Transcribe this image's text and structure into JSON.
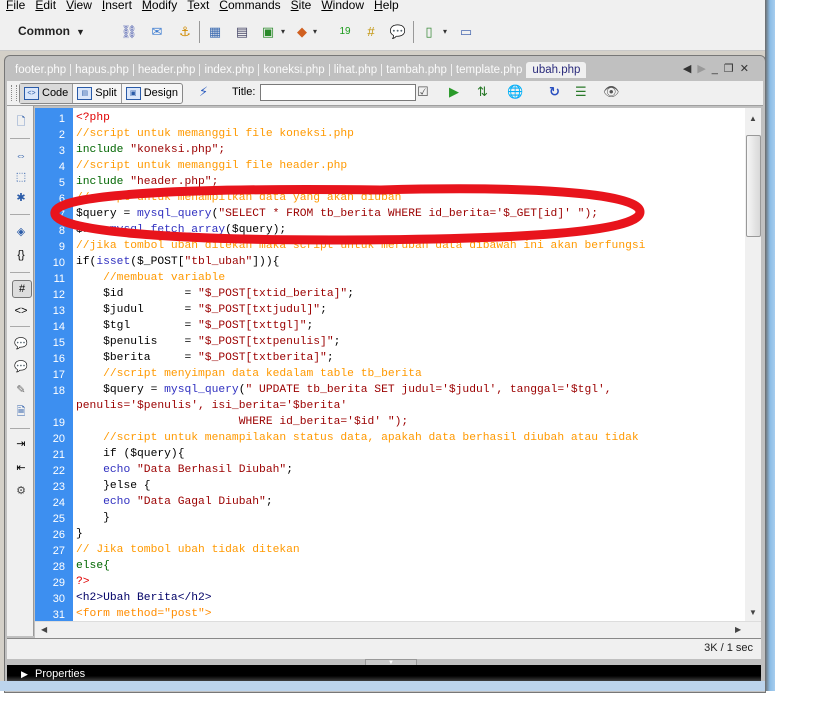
{
  "menu": [
    {
      "label": "File",
      "u": "F"
    },
    {
      "label": "Edit",
      "u": "E"
    },
    {
      "label": "View",
      "u": "V"
    },
    {
      "label": "Insert",
      "u": "I"
    },
    {
      "label": "Modify",
      "u": "M"
    },
    {
      "label": "Text",
      "u": "T"
    },
    {
      "label": "Commands",
      "u": "C"
    },
    {
      "label": "Site",
      "u": "S"
    },
    {
      "label": "Window",
      "u": "W"
    },
    {
      "label": "Help",
      "u": "H"
    }
  ],
  "insert_bar": {
    "category": "Common",
    "icons": [
      "hyperlink-icon",
      "email-link-icon",
      "named-anchor-icon",
      "table-icon",
      "insert-div-icon",
      "image-icon",
      "media-icon",
      "date-icon",
      "server-side-include-icon",
      "comment-icon",
      "head-icon",
      "template-icon"
    ]
  },
  "tabs": [
    "footer.php",
    "hapus.php",
    "header.php",
    "index.php",
    "koneksi.php",
    "lihat.php",
    "tambah.php",
    "template.php",
    "ubah.php"
  ],
  "active_tab": "ubah.php",
  "doc_toolbar": {
    "code_label": "Code",
    "split_label": "Split",
    "design_label": "Design",
    "title_label": "Title:",
    "title_value": ""
  },
  "code_lines": [
    {
      "n": "1",
      "t": "<?php",
      "c": "tag"
    },
    {
      "n": "2",
      "t": "//script untuk memanggil file koneksi.php",
      "c": "cmt"
    },
    {
      "n": "3",
      "t": "include \"koneksi.php\";",
      "c": "inc"
    },
    {
      "n": "4",
      "t": "//script untuk memanggil file header.php",
      "c": "cmt"
    },
    {
      "n": "5",
      "t": "include \"header.php\";",
      "c": "inc"
    },
    {
      "n": "6",
      "t": "//script untuk menampilkan data yang akan diubah",
      "c": "cmt"
    },
    {
      "n": "7",
      "t": "$query = mysql_query(\"SELECT * FROM tb_berita WHERE id_berita='$_GET[id]' \");",
      "c": "q"
    },
    {
      "n": "8",
      "t": "$r = mysql_fetch_array($query);",
      "c": "fa"
    },
    {
      "n": "9",
      "t": "//jika tombol ubah ditekan maka script untuk merubah data dibawah ini akan berfungsi",
      "c": "cmt"
    },
    {
      "n": "10",
      "t": "if(isset($_POST[\"tbl_ubah\"])){",
      "c": "if"
    },
    {
      "n": "11",
      "t": "    //membuat variable",
      "c": "cmt"
    },
    {
      "n": "12",
      "t": "    $id         = \"$_POST[txtid_berita]\";",
      "c": "as"
    },
    {
      "n": "13",
      "t": "    $judul      = \"$_POST[txtjudul]\";",
      "c": "as"
    },
    {
      "n": "14",
      "t": "    $tgl        = \"$_POST[txttgl]\";",
      "c": "as"
    },
    {
      "n": "15",
      "t": "    $penulis    = \"$_POST[txtpenulis]\";",
      "c": "as"
    },
    {
      "n": "16",
      "t": "    $berita     = \"$_POST[txtberita]\";",
      "c": "as"
    },
    {
      "n": "17",
      "t": "    //script menyimpan data kedalam table tb_berita",
      "c": "cmt"
    },
    {
      "n": "18",
      "t": "    $query = mysql_query(\" UPDATE tb_berita SET judul='$judul', tanggal='$tgl',",
      "c": "q"
    },
    {
      "n": "",
      "t": "penulis='$penulis', isi_berita='$berita'",
      "c": "str"
    },
    {
      "n": "19",
      "t": "                        WHERE id_berita='$id' \");",
      "c": "str"
    },
    {
      "n": "20",
      "t": "    //script untuk menampilakan status data, apakah data berhasil diubah atau tidak",
      "c": "cmt"
    },
    {
      "n": "21",
      "t": "    if ($query){",
      "c": "plain"
    },
    {
      "n": "22",
      "t": "    echo \"Data Berhasil Diubah\";",
      "c": "echo"
    },
    {
      "n": "23",
      "t": "    }else {",
      "c": "plain"
    },
    {
      "n": "24",
      "t": "    echo \"Data Gagal Diubah\";",
      "c": "echo"
    },
    {
      "n": "25",
      "t": "    }",
      "c": "plain"
    },
    {
      "n": "26",
      "t": "}",
      "c": "plain"
    },
    {
      "n": "27",
      "t": "// Jika tombol ubah tidak ditekan",
      "c": "cmt"
    },
    {
      "n": "28",
      "t": "else{",
      "c": "kw"
    },
    {
      "n": "29",
      "t": "?>",
      "c": "tag"
    },
    {
      "n": "30",
      "t": "<h2>Ubah Berita</h2>",
      "c": "html"
    },
    {
      "n": "31",
      "t": "<form method=\"post\">",
      "c": "frm"
    }
  ],
  "status": {
    "download": "3K / 1 sec"
  },
  "properties_panel": {
    "label": "Properties"
  },
  "annotation": {
    "color": "#e8141c",
    "shape": "ellipse",
    "highlights_line": "7"
  }
}
